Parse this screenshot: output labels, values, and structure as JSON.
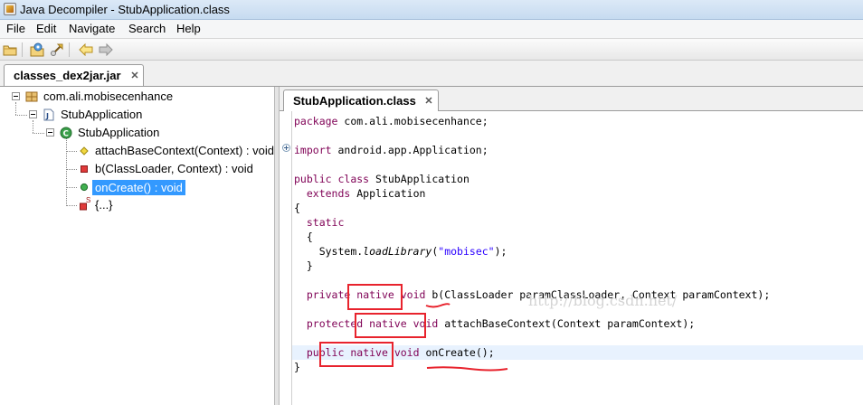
{
  "window": {
    "title": "Java Decompiler - StubApplication.class"
  },
  "menu": {
    "items": [
      "File",
      "Edit",
      "Navigate",
      "Search",
      "Help"
    ]
  },
  "toolbar": {
    "buttons": [
      "open-file-icon",
      "open-type-icon",
      "jump-icon",
      "back-arrow-icon",
      "forward-arrow-icon"
    ]
  },
  "outer_tab": {
    "label": "classes_dex2jar.jar"
  },
  "tree": {
    "package": "com.ali.mobisecenhance",
    "file": "StubApplication",
    "class": "StubApplication",
    "members": [
      "attachBaseContext(Context) : void",
      "b(ClassLoader, Context) : void",
      "onCreate() : void",
      "{...}"
    ],
    "static_marker": "S"
  },
  "editor_tab": {
    "label": "StubApplication.class"
  },
  "code": {
    "package_kw": "package",
    "package_name": " com.ali.mobisecenhance;",
    "import_kw": "import",
    "import_name": " android.app.Application;",
    "public": "public",
    "class": "class",
    "class_name": " StubApplication",
    "extends": "extends",
    "extends_name": " Application",
    "brace_open": "{",
    "static": "static",
    "inner_brace_open": "{",
    "system": "System.",
    "load_library": "loadLibrary",
    "paren_open": "(",
    "library_string": "\"mobisec\"",
    "paren_close": ");",
    "inner_brace_close": "}",
    "private": "private",
    "native": "native",
    "void": "void",
    "method_b": " b(ClassLoader paramClassLoader, Context paramContext);",
    "protected": "protected",
    "method_attach": " attachBaseContext(Context paramContext);",
    "method_oncreate": " onCreate();",
    "brace_close": "}"
  },
  "watermark": "http://blog.csdn.net/",
  "colors": {
    "annotation": "#e8232d",
    "selection": "#3399ff",
    "keyword": "#7f0055",
    "string": "#2a00ff"
  }
}
